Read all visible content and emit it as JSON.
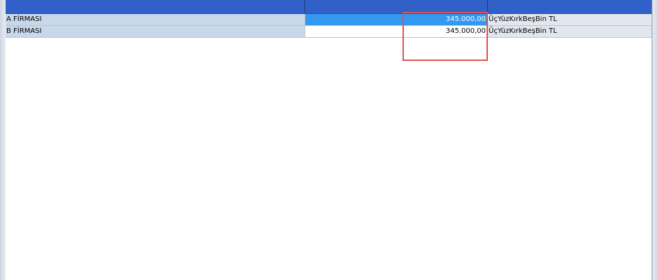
{
  "grid": {
    "header": {
      "col1": "",
      "col2": "",
      "col3": ""
    },
    "rows": [
      {
        "company": "A FİRMASI",
        "amount": "345.000,00",
        "amount_text": "ÜçYüzKırkBeşBin  TL"
      },
      {
        "company": "B FİRMASI",
        "amount": "345.000,00",
        "amount_text": "ÜçYüzKırkBeşBin  TL"
      }
    ]
  },
  "colors": {
    "header_bg": "#3060c8",
    "selected_cell_bg": "#3399f0",
    "highlight_border": "#e05050"
  }
}
